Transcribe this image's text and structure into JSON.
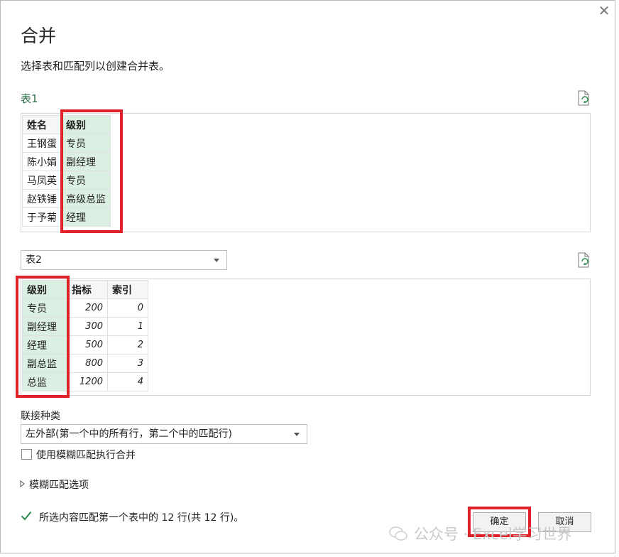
{
  "dialog": {
    "title": "合并",
    "subtitle": "选择表和匹配列以创建合并表。",
    "close_symbol": "✕"
  },
  "table1": {
    "label": "表1",
    "refresh_icon": "refresh-file-icon",
    "headers": [
      "姓名",
      "级别"
    ],
    "rows": [
      [
        "王钢蛋",
        "专员"
      ],
      [
        "陈小娟",
        "副经理"
      ],
      [
        "马凤英",
        "专员"
      ],
      [
        "赵铁锤",
        "高级总监"
      ],
      [
        "于予菊",
        "经理"
      ]
    ],
    "highlight_color": "#dcefe3"
  },
  "table2": {
    "selected": "表2",
    "refresh_icon": "refresh-file-icon",
    "headers": [
      "级别",
      "指标",
      "索引"
    ],
    "rows": [
      [
        "专员",
        "200",
        "0"
      ],
      [
        "副经理",
        "300",
        "1"
      ],
      [
        "经理",
        "500",
        "2"
      ],
      [
        "副总监",
        "800",
        "3"
      ],
      [
        "总监",
        "1200",
        "4"
      ]
    ]
  },
  "join": {
    "label": "联接种类",
    "selected": "左外部(第一个中的所有行，第二个中的匹配行)",
    "fuzzy_checkbox_label": "使用模糊匹配执行合并",
    "fuzzy_checked": false,
    "fuzzy_options_label": "模糊匹配选项"
  },
  "status": {
    "text": "所选内容匹配第一个表中的 12 行(共 12 行)。",
    "icon": "checkmark-icon",
    "color": "#2b8a4e"
  },
  "buttons": {
    "ok": "确定",
    "cancel": "取消"
  },
  "annotation_color": "#e0222a",
  "watermark": {
    "text": "公众号 · Excel学习世界",
    "icon": "wechat-icon"
  }
}
